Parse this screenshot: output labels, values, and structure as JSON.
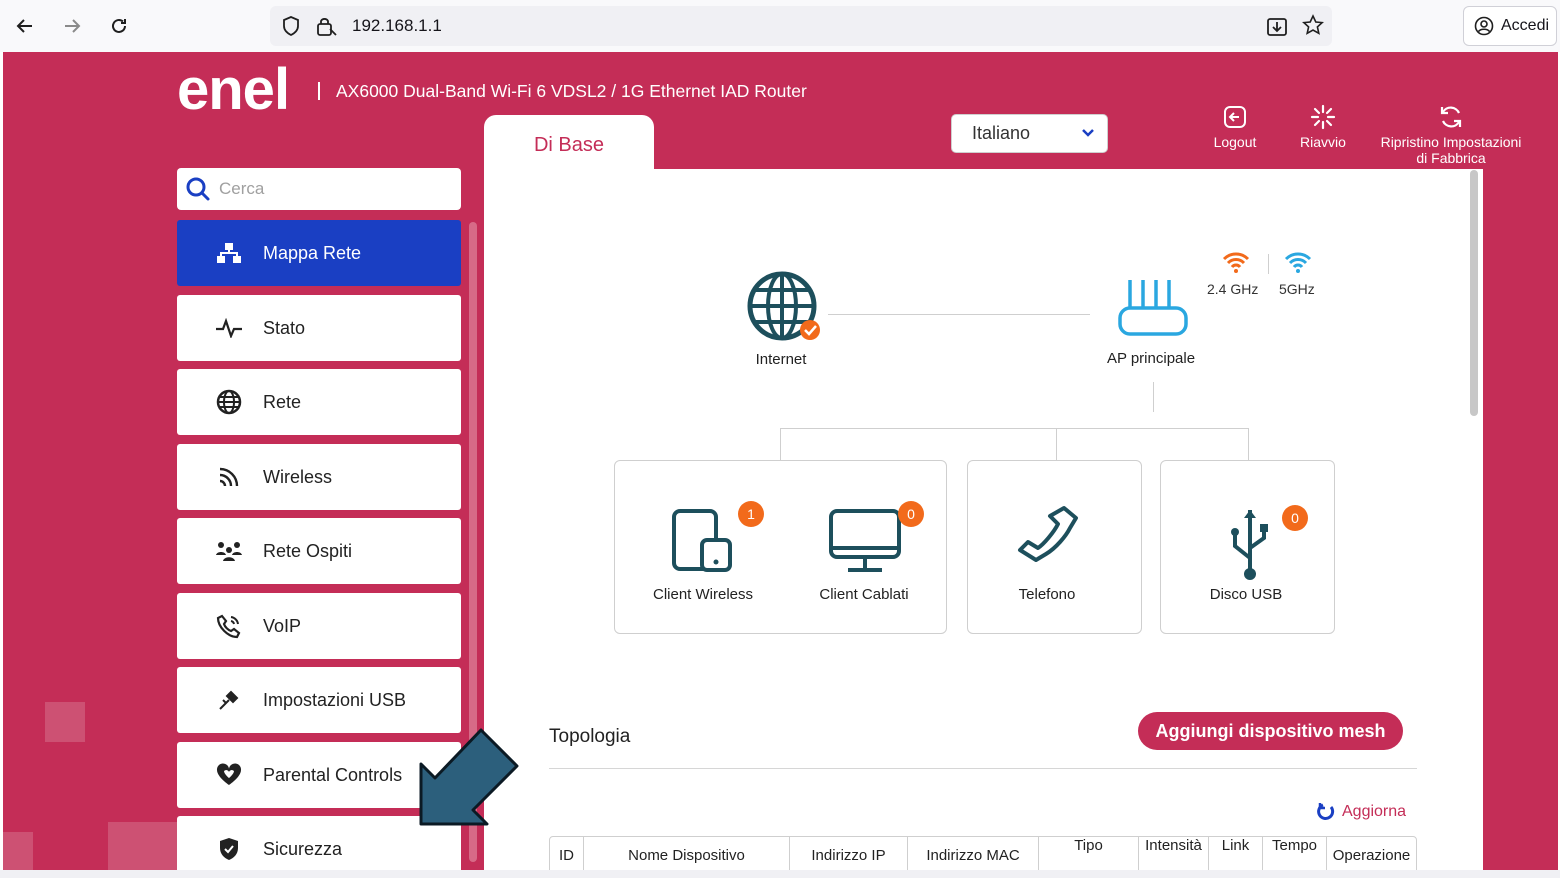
{
  "browser": {
    "url": "192.168.1.1",
    "signin_label": "Accedi",
    "icons": [
      "back-arrow-icon",
      "forward-arrow-icon",
      "reload-icon",
      "shield-icon",
      "lock-icon",
      "download-icon",
      "star-icon",
      "account-icon"
    ]
  },
  "header": {
    "logo_text": "enel",
    "router_title": "AX6000 Dual-Band Wi-Fi 6 VDSL2 / 1G Ethernet IAD Router",
    "tab_label": "Di Base",
    "language": "Italiano",
    "actions": {
      "logout": "Logout",
      "reboot": "Riavvio",
      "factory_line1": "Ripristino Impostazioni",
      "factory_line2": "di Fabbrica"
    }
  },
  "sidebar": {
    "search_placeholder": "Cerca",
    "items": [
      {
        "label": "Mappa Rete",
        "icon": "network-map-icon",
        "active": true
      },
      {
        "label": "Stato",
        "icon": "pulse-icon"
      },
      {
        "label": "Rete",
        "icon": "globe-icon"
      },
      {
        "label": "Wireless",
        "icon": "wireless-icon"
      },
      {
        "label": "Rete Ospiti",
        "icon": "guests-icon"
      },
      {
        "label": "VoIP",
        "icon": "phone-icon"
      },
      {
        "label": "Impostazioni USB",
        "icon": "usb-icon"
      },
      {
        "label": "Parental Controls",
        "icon": "heart-icon"
      },
      {
        "label": "Sicurezza",
        "icon": "shield-icon"
      }
    ]
  },
  "network_map": {
    "internet_label": "Internet",
    "ap_label": "AP principale",
    "band_24": "2.4 GHz",
    "band_5": "5GHz",
    "devices": [
      {
        "label": "Client Wireless",
        "count": "1"
      },
      {
        "label": "Client Cablati",
        "count": "0"
      },
      {
        "label": "Telefono"
      },
      {
        "label": "Disco USB",
        "count": "0"
      }
    ]
  },
  "topology": {
    "title": "Topologia",
    "add_mesh_label": "Aggiungi dispositivo mesh",
    "refresh_label": "Aggiorna",
    "columns": [
      "ID",
      "Nome Dispositivo",
      "Indirizzo IP",
      "Indirizzo MAC",
      "Tipo",
      "Intensità",
      "Link",
      "Tempo",
      "Operazione"
    ]
  },
  "colors": {
    "brand": "#c42d57",
    "active_nav": "#1a3fc3",
    "icon_teal": "#1d4f5c",
    "badge": "#f26a1b",
    "overlay_arrow": "#2c5f7c"
  }
}
